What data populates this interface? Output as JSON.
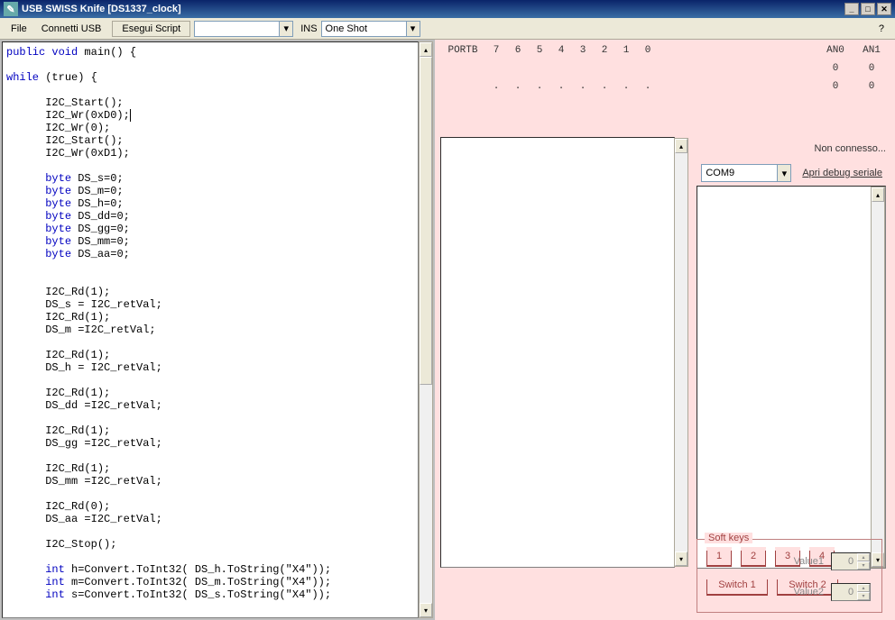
{
  "window": {
    "title": "USB SWISS Knife [DS1337_clock]"
  },
  "menu": {
    "file": "File",
    "connect": "Connetti USB",
    "execute": "Esegui Script",
    "ins": "INS",
    "mode": "One Shot",
    "help": "?"
  },
  "ports": {
    "label": "PORTB",
    "bits": [
      "7",
      "6",
      "5",
      "4",
      "3",
      "2",
      "1",
      "0"
    ],
    "an0": "AN0",
    "an1": "AN1",
    "zero": "0",
    "dot": "."
  },
  "status": {
    "text": "Non connesso..."
  },
  "serial": {
    "port": "COM9",
    "open": "Apri debug seriale"
  },
  "softkeys": {
    "legend": "Soft keys",
    "k1": "1",
    "k2": "2",
    "k3": "3",
    "k4": "4",
    "s1": "Switch 1",
    "s2": "Switch 2",
    "value1_label": "Value1",
    "value2_label": "Value2",
    "value1": "0",
    "value2": "0"
  },
  "code": [
    {
      "kw": "public void",
      "rest": " main() {"
    },
    {
      "empty": true
    },
    {
      "kw": "while",
      "rest": " (true) {"
    },
    {
      "empty": true
    },
    {
      "indent": 2,
      "rest": "I2C_Start();"
    },
    {
      "indent": 2,
      "rest": "I2C_Wr(0xD0);",
      "cursor": true
    },
    {
      "indent": 2,
      "rest": "I2C_Wr(0);"
    },
    {
      "indent": 2,
      "rest": "I2C_Start();"
    },
    {
      "indent": 2,
      "rest": "I2C_Wr(0xD1);"
    },
    {
      "empty": true
    },
    {
      "indent": 2,
      "kw": "byte",
      "rest": " DS_s=0;"
    },
    {
      "indent": 2,
      "kw": "byte",
      "rest": " DS_m=0;"
    },
    {
      "indent": 2,
      "kw": "byte",
      "rest": " DS_h=0;"
    },
    {
      "indent": 2,
      "kw": "byte",
      "rest": " DS_dd=0;"
    },
    {
      "indent": 2,
      "kw": "byte",
      "rest": " DS_gg=0;"
    },
    {
      "indent": 2,
      "kw": "byte",
      "rest": " DS_mm=0;"
    },
    {
      "indent": 2,
      "kw": "byte",
      "rest": " DS_aa=0;"
    },
    {
      "empty": true
    },
    {
      "empty": true
    },
    {
      "indent": 2,
      "rest": "I2C_Rd(1);"
    },
    {
      "indent": 2,
      "rest": "DS_s = I2C_retVal;"
    },
    {
      "indent": 2,
      "rest": "I2C_Rd(1);"
    },
    {
      "indent": 2,
      "rest": "DS_m =I2C_retVal;"
    },
    {
      "empty": true
    },
    {
      "indent": 2,
      "rest": "I2C_Rd(1);"
    },
    {
      "indent": 2,
      "rest": "DS_h = I2C_retVal;"
    },
    {
      "empty": true
    },
    {
      "indent": 2,
      "rest": "I2C_Rd(1);"
    },
    {
      "indent": 2,
      "rest": "DS_dd =I2C_retVal;"
    },
    {
      "empty": true
    },
    {
      "indent": 2,
      "rest": "I2C_Rd(1);"
    },
    {
      "indent": 2,
      "rest": "DS_gg =I2C_retVal;"
    },
    {
      "empty": true
    },
    {
      "indent": 2,
      "rest": "I2C_Rd(1);"
    },
    {
      "indent": 2,
      "rest": "DS_mm =I2C_retVal;"
    },
    {
      "empty": true
    },
    {
      "indent": 2,
      "rest": "I2C_Rd(0);"
    },
    {
      "indent": 2,
      "rest": "DS_aa =I2C_retVal;"
    },
    {
      "empty": true
    },
    {
      "indent": 2,
      "rest": "I2C_Stop();"
    },
    {
      "empty": true
    },
    {
      "indent": 2,
      "kw": "int",
      "rest": " h=Convert.ToInt32( DS_h.ToString(\"X4\"));"
    },
    {
      "indent": 2,
      "kw": "int",
      "rest": " m=Convert.ToInt32( DS_m.ToString(\"X4\"));"
    },
    {
      "indent": 2,
      "kw": "int",
      "rest": " s=Convert.ToInt32( DS_s.ToString(\"X4\"));"
    }
  ]
}
